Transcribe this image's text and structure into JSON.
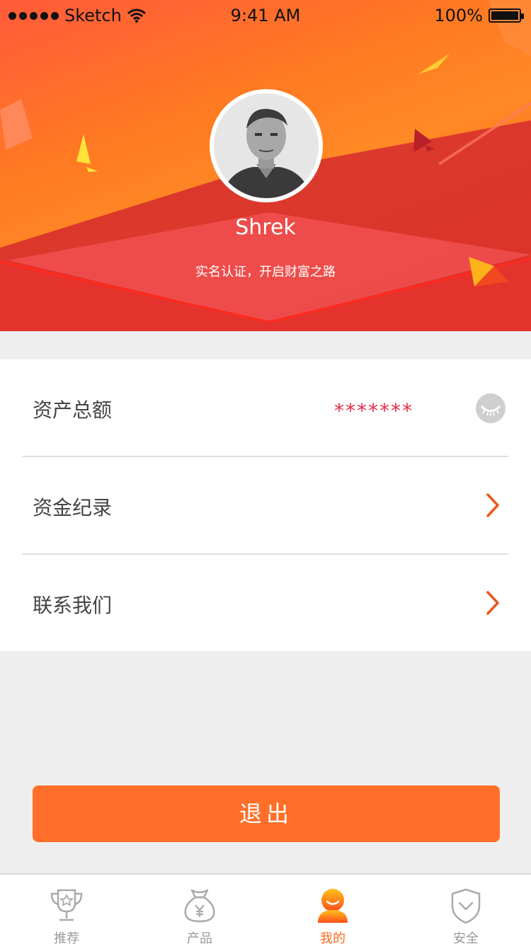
{
  "status_bar": {
    "carrier": "Sketch",
    "time": "9:41 AM",
    "battery": "100%"
  },
  "profile": {
    "username": "Shrek",
    "subtitle": "实名认证，开启财富之路"
  },
  "menu": {
    "items": [
      {
        "label": "资产总额",
        "value": "*******"
      },
      {
        "label": "资金纪录"
      },
      {
        "label": "联系我们"
      }
    ]
  },
  "actions": {
    "logout_label": "退出"
  },
  "tabbar": {
    "tabs": [
      {
        "label": "推荐",
        "icon": "trophy-icon"
      },
      {
        "label": "产品",
        "icon": "money-bag-icon"
      },
      {
        "label": "我的",
        "icon": "user-icon",
        "active": true
      },
      {
        "label": "安全",
        "icon": "shield-icon"
      }
    ]
  },
  "colors": {
    "accent": "#ff6f29",
    "masked_value": "#ea2b46"
  }
}
